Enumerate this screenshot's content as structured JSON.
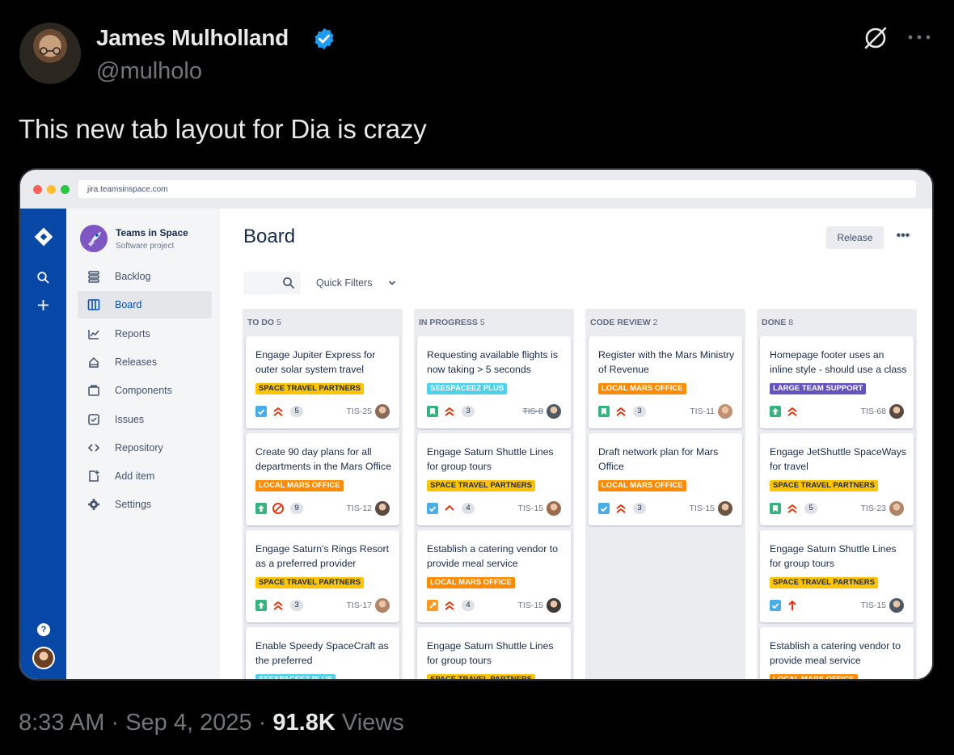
{
  "tweet": {
    "author_name": "James Mulholland",
    "handle": "@mulholo",
    "text": "This new tab layout for Dia is crazy",
    "time": "8:33 AM",
    "date": "Sep 4, 2025",
    "views_count": "91.8K",
    "views_label": "Views",
    "separator": "·"
  },
  "browser": {
    "url": "jira.teamsinspace.com"
  },
  "project": {
    "name": "Teams in Space",
    "type": "Software project"
  },
  "nav": [
    {
      "label": "Backlog",
      "icon": "backlog-icon"
    },
    {
      "label": "Board",
      "icon": "board-icon",
      "active": true
    },
    {
      "label": "Reports",
      "icon": "reports-icon"
    },
    {
      "label": "Releases",
      "icon": "releases-icon"
    },
    {
      "label": "Components",
      "icon": "components-icon"
    },
    {
      "label": "Issues",
      "icon": "issues-icon"
    },
    {
      "label": "Repository",
      "icon": "repository-icon"
    },
    {
      "label": "Add item",
      "icon": "add-item-icon"
    },
    {
      "label": "Settings",
      "icon": "settings-icon"
    }
  ],
  "board": {
    "title": "Board",
    "release_label": "Release",
    "more_label": "•••",
    "quick_filters": "Quick Filters"
  },
  "colors": {
    "space_travel": "#ffc400",
    "local_mars": "#ff8b00",
    "seespaceez": "#4fd1e9",
    "large_team": "#6554c0",
    "story": "#36b37e",
    "task": "#4bade8",
    "bug_red": "#de350b",
    "improvement": "#ff991f"
  },
  "columns": [
    {
      "name": "TO DO",
      "count": "5",
      "cards": [
        {
          "title": "Engage Jupiter Express for outer solar system travel",
          "label": "SPACE TRAVEL PARTNERS",
          "label_color": "#ffc400",
          "label_text_color": "#172b4d",
          "type": "task",
          "priority": "highest",
          "points": "5",
          "key": "TIS-25"
        },
        {
          "title": "Create 90 day plans for all departments in the Mars Office",
          "label": "LOCAL MARS OFFICE",
          "label_color": "#ff8b00",
          "label_text_color": "#ffffff",
          "type": "improvement-green",
          "priority": "blocker",
          "points": "9",
          "key": "TIS-12"
        },
        {
          "title": "Engage Saturn's Rings Resort as a preferred provider",
          "label": "SPACE TRAVEL PARTNERS",
          "label_color": "#ffc400",
          "label_text_color": "#172b4d",
          "type": "improvement-green",
          "priority": "highest",
          "points": "3",
          "key": "TIS-17"
        },
        {
          "title": "Enable Speedy SpaceCraft as the preferred",
          "label": "SEESPACEEZ PLUS",
          "label_color": "#4fd1e9",
          "label_text_color": "#ffffff",
          "type": "task",
          "priority": "highest",
          "points": "",
          "key": ""
        }
      ]
    },
    {
      "name": "IN PROGRESS",
      "count": "5",
      "cards": [
        {
          "title": "Requesting available flights is now taking > 5 seconds",
          "label": "SEESPACEEZ PLUS",
          "label_color": "#4fd1e9",
          "label_text_color": "#ffffff",
          "type": "story",
          "priority": "highest",
          "points": "3",
          "key": "TIS-8",
          "key_done": true
        },
        {
          "title": "Engage Saturn Shuttle Lines for group tours",
          "label": "SPACE TRAVEL PARTNERS",
          "label_color": "#ffc400",
          "label_text_color": "#172b4d",
          "type": "task",
          "priority": "high",
          "points": "4",
          "key": "TIS-15"
        },
        {
          "title": "Establish a catering vendor to provide meal service",
          "label": "LOCAL MARS OFFICE",
          "label_color": "#ff8b00",
          "label_text_color": "#ffffff",
          "type": "improvement",
          "priority": "highest",
          "points": "4",
          "key": "TIS-15"
        },
        {
          "title": "Engage Saturn Shuttle Lines for group tours",
          "label": "SPACE TRAVEL PARTNERS",
          "label_color": "#ffc400",
          "label_text_color": "#172b4d",
          "type": "task",
          "priority": "high",
          "points": "",
          "key": ""
        }
      ]
    },
    {
      "name": "CODE REVIEW",
      "count": "2",
      "cards": [
        {
          "title": "Register with the Mars Ministry of Revenue",
          "label": "LOCAL MARS OFFICE",
          "label_color": "#ff8b00",
          "label_text_color": "#ffffff",
          "type": "story",
          "priority": "highest",
          "points": "3",
          "key": "TIS-11"
        },
        {
          "title": "Draft network plan for Mars Office",
          "label": "LOCAL MARS OFFICE",
          "label_color": "#ff8b00",
          "label_text_color": "#ffffff",
          "type": "task",
          "priority": "highest",
          "points": "3",
          "key": "TIS-15"
        }
      ]
    },
    {
      "name": "DONE",
      "count": "8",
      "cards": [
        {
          "title": "Homepage footer uses an inline style - should use a class",
          "label": "LARGE TEAM SUPPORT",
          "label_color": "#6554c0",
          "label_text_color": "#ffffff",
          "type": "improvement-green",
          "priority": "highest",
          "points": "",
          "key": "TIS-68"
        },
        {
          "title": "Engage JetShuttle SpaceWays for travel",
          "label": "SPACE TRAVEL PARTNERS",
          "label_color": "#ffc400",
          "label_text_color": "#172b4d",
          "type": "story",
          "priority": "highest",
          "points": "5",
          "key": "TIS-23"
        },
        {
          "title": "Engage Saturn Shuttle Lines for group tours",
          "label": "SPACE TRAVEL PARTNERS",
          "label_color": "#ffc400",
          "label_text_color": "#172b4d",
          "type": "task",
          "priority": "arrow-up",
          "points": "",
          "key": "TIS-15"
        },
        {
          "title": "Establish a catering vendor to provide meal service",
          "label": "LOCAL MARS OFFICE",
          "label_color": "#ff8b00",
          "label_text_color": "#ffffff",
          "type": "task",
          "priority": "highest",
          "points": "",
          "key": ""
        }
      ]
    }
  ]
}
